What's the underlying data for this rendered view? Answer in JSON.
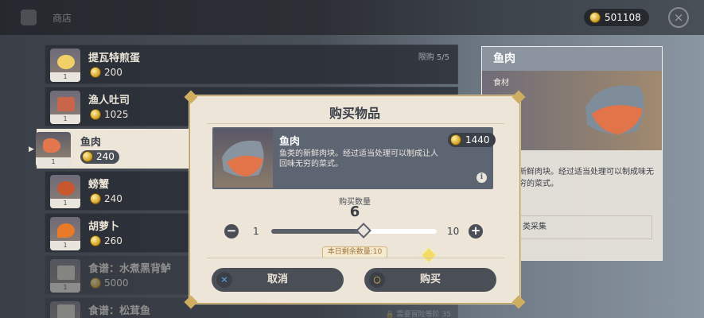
{
  "header": {
    "title": "商店",
    "currency": "501108",
    "close_label": "×"
  },
  "shop_items": [
    {
      "name": "提瓦特煎蛋",
      "price": "200",
      "count": "1",
      "limit": "限购 5/5",
      "locked_text": ""
    },
    {
      "name": "渔人吐司",
      "price": "1025",
      "count": "1",
      "limit": "",
      "locked_text": ""
    },
    {
      "name": "鱼肉",
      "price": "240",
      "count": "1",
      "limit": "",
      "locked_text": ""
    },
    {
      "name": "螃蟹",
      "price": "240",
      "count": "1",
      "limit": "",
      "locked_text": ""
    },
    {
      "name": "胡萝卜",
      "price": "260",
      "count": "1",
      "limit": "",
      "locked_text": ""
    },
    {
      "name": "食谱：水煮黑背鲈",
      "price": "5000",
      "count": "1",
      "limit": "",
      "locked_text": ""
    },
    {
      "name": "食谱：松茸鱼",
      "price": "",
      "count": "",
      "limit": "",
      "locked_text": "需要冒险等阶 35"
    }
  ],
  "detail": {
    "name": "鱼肉",
    "category": "食材",
    "description": "新鲜肉块。经过适当处理可以制成味无穷的菜式。",
    "source": "类采集"
  },
  "dialog": {
    "title": "购买物品",
    "item_name": "鱼肉",
    "item_desc": "鱼类的新鲜肉块。经过适当处理可以制成让人回味无穷的菜式。",
    "item_price": "1440",
    "info_label": "i",
    "quantity_label": "购买数量",
    "quantity": "6",
    "min": "1",
    "max": "10",
    "slider_fraction": 0.56,
    "remaining": "本日剩余数量:10",
    "minus_label": "−",
    "plus_label": "+",
    "cancel_label": "取消",
    "confirm_label": "购买",
    "cancel_icon": "×",
    "confirm_icon": "○"
  }
}
